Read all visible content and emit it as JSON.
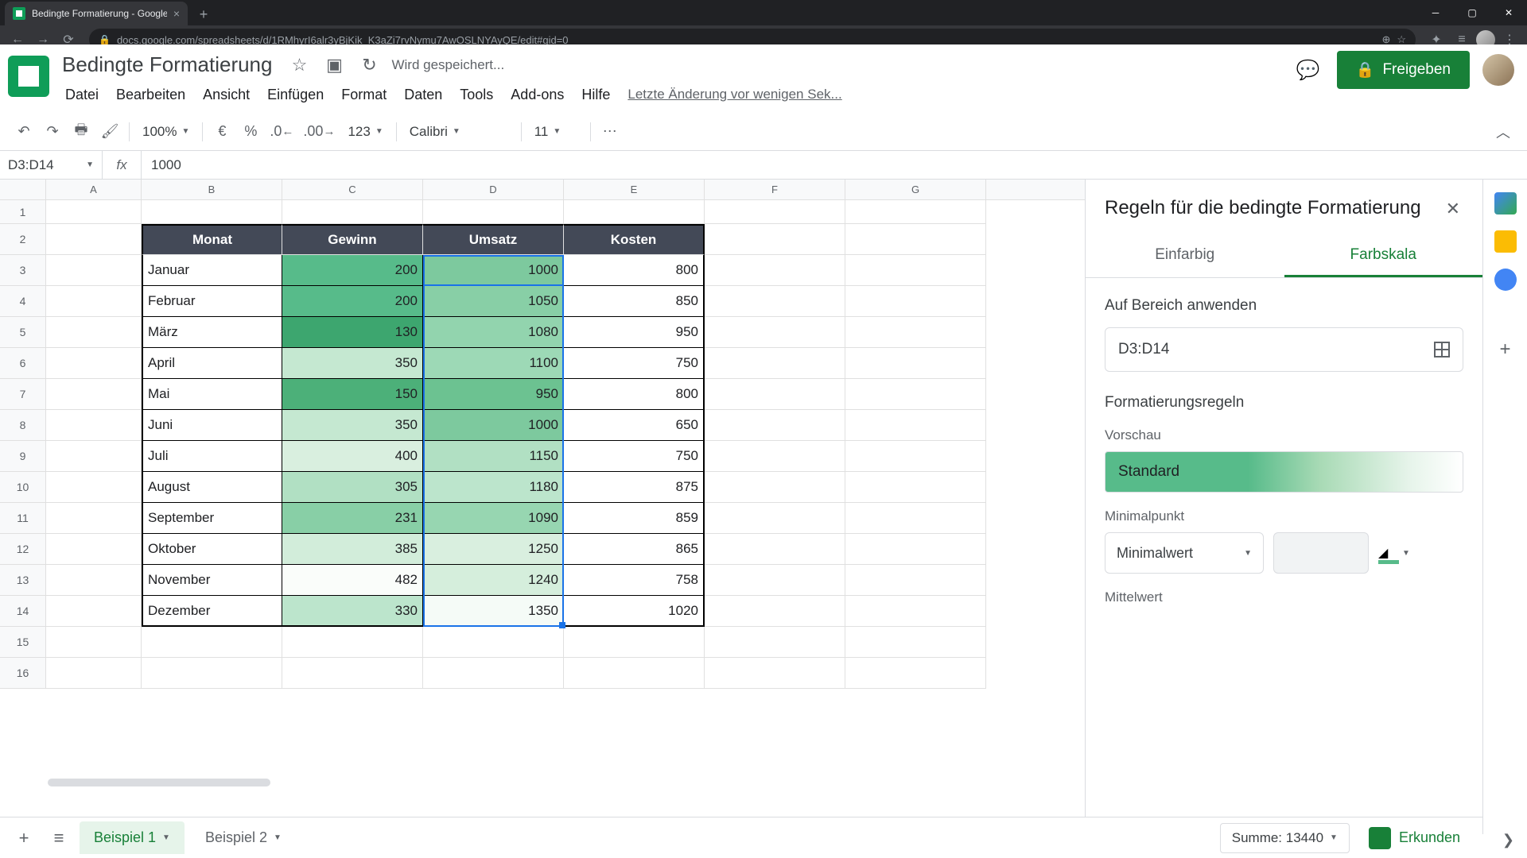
{
  "browser": {
    "tab_title": "Bedingte Formatierung - Google",
    "url": "docs.google.com/spreadsheets/d/1RMhyrI6alr3yBjKik_K3aZi7rvNymu7AwOSLNYAyQE/edit#gid=0"
  },
  "doc": {
    "title": "Bedingte Formatierung",
    "save_status": "Wird gespeichert...",
    "last_edit": "Letzte Änderung vor wenigen Sek...",
    "share_label": "Freigeben"
  },
  "menus": [
    "Datei",
    "Bearbeiten",
    "Ansicht",
    "Einfügen",
    "Format",
    "Daten",
    "Tools",
    "Add-ons",
    "Hilfe"
  ],
  "toolbar": {
    "zoom": "100%",
    "currency": "€",
    "percent": "%",
    "dec_less": ".0",
    "dec_more": ".00",
    "num_format": "123",
    "font": "Calibri",
    "font_size": "11"
  },
  "formula": {
    "range": "D3:D14",
    "value": "1000"
  },
  "cols": [
    "A",
    "B",
    "C",
    "D",
    "E",
    "F",
    "G"
  ],
  "table": {
    "headers": [
      "Monat",
      "Gewinn",
      "Umsatz",
      "Kosten"
    ],
    "rows": [
      {
        "m": "Januar",
        "g": "200",
        "u": "1000",
        "k": "800",
        "cg": "#57bb8a",
        "cu": "#7dc99e"
      },
      {
        "m": "Februar",
        "g": "200",
        "u": "1050",
        "k": "850",
        "cg": "#57bb8a",
        "cu": "#88cfa6"
      },
      {
        "m": "März",
        "g": "130",
        "u": "1080",
        "k": "950",
        "cg": "#3da66f",
        "cu": "#92d4ae"
      },
      {
        "m": "April",
        "g": "350",
        "u": "1100",
        "k": "750",
        "cg": "#c5e8d1",
        "cu": "#9dd9b6"
      },
      {
        "m": "Mai",
        "g": "150",
        "u": "950",
        "k": "800",
        "cg": "#4cb079",
        "cu": "#6cc291"
      },
      {
        "m": "Juni",
        "g": "350",
        "u": "1000",
        "k": "650",
        "cg": "#c5e8d1",
        "cu": "#7dc99e"
      },
      {
        "m": "Juli",
        "g": "400",
        "u": "1150",
        "k": "750",
        "cg": "#d9efdf",
        "cu": "#b1e0c3"
      },
      {
        "m": "August",
        "g": "305",
        "u": "1180",
        "k": "875",
        "cg": "#b1e0c3",
        "cu": "#bce5cc"
      },
      {
        "m": "September",
        "g": "231",
        "u": "1090",
        "k": "859",
        "cg": "#88cfa6",
        "cu": "#97d6b1"
      },
      {
        "m": "Oktober",
        "g": "385",
        "u": "1250",
        "k": "865",
        "cg": "#d2edda",
        "cu": "#d9efdf"
      },
      {
        "m": "November",
        "g": "482",
        "u": "1240",
        "k": "758",
        "cg": "#fafdfa",
        "cu": "#d5eedc"
      },
      {
        "m": "Dezember",
        "g": "330",
        "u": "1350",
        "k": "1020",
        "cg": "#bce5cc",
        "cu": "#f5fbf7"
      }
    ]
  },
  "panel": {
    "title": "Regeln für die bedingte Formatierung",
    "tab_single": "Einfarbig",
    "tab_scale": "Farbskala",
    "range_label": "Auf Bereich anwenden",
    "range_value": "D3:D14",
    "rules_label": "Formatierungsregeln",
    "preview_label": "Vorschau",
    "preview_text": "Standard",
    "min_label": "Minimalpunkt",
    "min_select": "Minimalwert",
    "mid_label": "Mittelwert"
  },
  "sheets": {
    "tab1": "Beispiel 1",
    "tab2": "Beispiel 2",
    "sum": "Summe: 13440",
    "explore": "Erkunden"
  }
}
